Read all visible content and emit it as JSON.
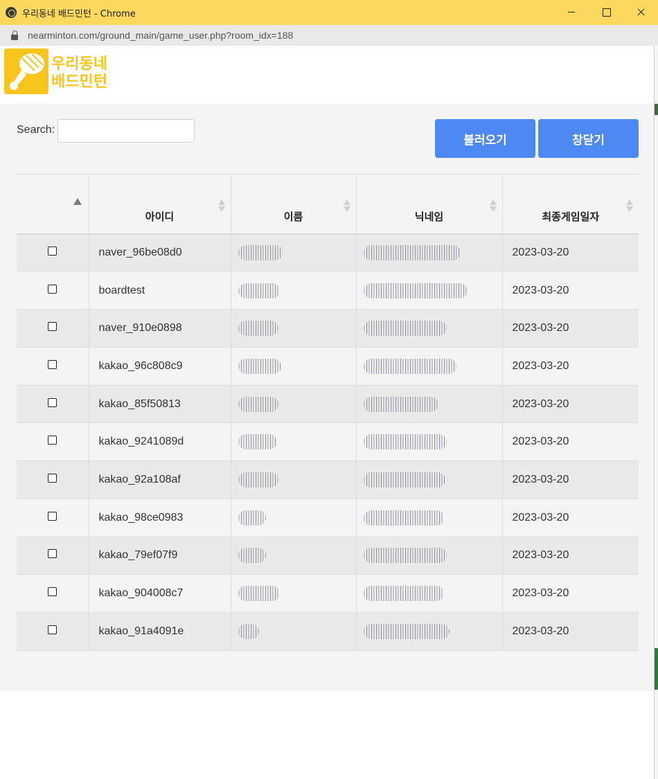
{
  "window": {
    "title": "우리동네 배드민턴 - Chrome",
    "url": "nearminton.com/ground_main/game_user.php?room_idx=188"
  },
  "logo": {
    "line1": "우리동네",
    "line2": "배드민턴",
    "brand_color": "#f7c51b"
  },
  "search": {
    "label": "Search:",
    "value": "",
    "placeholder": ""
  },
  "buttons": {
    "load_label": "불러오기",
    "close_label": "창닫기",
    "color": "#4c89f2"
  },
  "table": {
    "columns": [
      "",
      "아이디",
      "이름",
      "닉네임",
      "최종게임일자"
    ],
    "rows": [
      {
        "id": "naver_96be08d0",
        "date": "2023-03-20",
        "name_w": 64,
        "nick_w": 140
      },
      {
        "id": "boardtest",
        "date": "2023-03-20",
        "name_w": 60,
        "nick_w": 150
      },
      {
        "id": "naver_910e0898",
        "date": "2023-03-20",
        "name_w": 58,
        "nick_w": 120
      },
      {
        "id": "kakao_96c808c9",
        "date": "2023-03-20",
        "name_w": 62,
        "nick_w": 134
      },
      {
        "id": "kakao_85f50813",
        "date": "2023-03-20",
        "name_w": 58,
        "nick_w": 108
      },
      {
        "id": "kakao_9241089d",
        "date": "2023-03-20",
        "name_w": 56,
        "nick_w": 120
      },
      {
        "id": "kakao_92a108af",
        "date": "2023-03-20",
        "name_w": 58,
        "nick_w": 118
      },
      {
        "id": "kakao_98ce0983",
        "date": "2023-03-20",
        "name_w": 40,
        "nick_w": 116
      },
      {
        "id": "kakao_79ef07f9",
        "date": "2023-03-20",
        "name_w": 40,
        "nick_w": 120
      },
      {
        "id": "kakao_904008c7",
        "date": "2023-03-20",
        "name_w": 60,
        "nick_w": 116
      },
      {
        "id": "kakao_91a4091e",
        "date": "2023-03-20",
        "name_w": 30,
        "nick_w": 124
      }
    ]
  }
}
